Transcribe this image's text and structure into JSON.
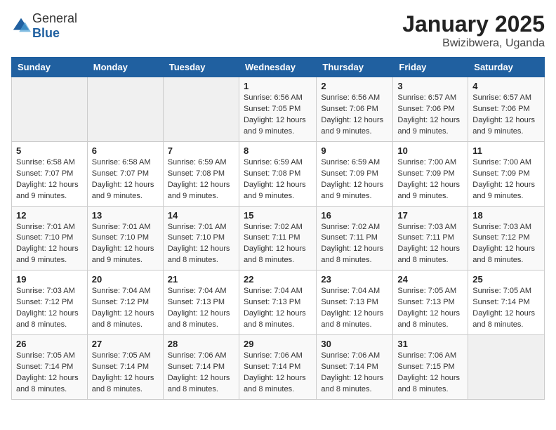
{
  "header": {
    "logo_general": "General",
    "logo_blue": "Blue",
    "title": "January 2025",
    "subtitle": "Bwizibwera, Uganda"
  },
  "weekdays": [
    "Sunday",
    "Monday",
    "Tuesday",
    "Wednesday",
    "Thursday",
    "Friday",
    "Saturday"
  ],
  "weeks": [
    [
      {
        "day": "",
        "sunrise": "",
        "sunset": "",
        "daylight": ""
      },
      {
        "day": "",
        "sunrise": "",
        "sunset": "",
        "daylight": ""
      },
      {
        "day": "",
        "sunrise": "",
        "sunset": "",
        "daylight": ""
      },
      {
        "day": "1",
        "sunrise": "Sunrise: 6:56 AM",
        "sunset": "Sunset: 7:05 PM",
        "daylight": "Daylight: 12 hours and 9 minutes."
      },
      {
        "day": "2",
        "sunrise": "Sunrise: 6:56 AM",
        "sunset": "Sunset: 7:06 PM",
        "daylight": "Daylight: 12 hours and 9 minutes."
      },
      {
        "day": "3",
        "sunrise": "Sunrise: 6:57 AM",
        "sunset": "Sunset: 7:06 PM",
        "daylight": "Daylight: 12 hours and 9 minutes."
      },
      {
        "day": "4",
        "sunrise": "Sunrise: 6:57 AM",
        "sunset": "Sunset: 7:06 PM",
        "daylight": "Daylight: 12 hours and 9 minutes."
      }
    ],
    [
      {
        "day": "5",
        "sunrise": "Sunrise: 6:58 AM",
        "sunset": "Sunset: 7:07 PM",
        "daylight": "Daylight: 12 hours and 9 minutes."
      },
      {
        "day": "6",
        "sunrise": "Sunrise: 6:58 AM",
        "sunset": "Sunset: 7:07 PM",
        "daylight": "Daylight: 12 hours and 9 minutes."
      },
      {
        "day": "7",
        "sunrise": "Sunrise: 6:59 AM",
        "sunset": "Sunset: 7:08 PM",
        "daylight": "Daylight: 12 hours and 9 minutes."
      },
      {
        "day": "8",
        "sunrise": "Sunrise: 6:59 AM",
        "sunset": "Sunset: 7:08 PM",
        "daylight": "Daylight: 12 hours and 9 minutes."
      },
      {
        "day": "9",
        "sunrise": "Sunrise: 6:59 AM",
        "sunset": "Sunset: 7:09 PM",
        "daylight": "Daylight: 12 hours and 9 minutes."
      },
      {
        "day": "10",
        "sunrise": "Sunrise: 7:00 AM",
        "sunset": "Sunset: 7:09 PM",
        "daylight": "Daylight: 12 hours and 9 minutes."
      },
      {
        "day": "11",
        "sunrise": "Sunrise: 7:00 AM",
        "sunset": "Sunset: 7:09 PM",
        "daylight": "Daylight: 12 hours and 9 minutes."
      }
    ],
    [
      {
        "day": "12",
        "sunrise": "Sunrise: 7:01 AM",
        "sunset": "Sunset: 7:10 PM",
        "daylight": "Daylight: 12 hours and 9 minutes."
      },
      {
        "day": "13",
        "sunrise": "Sunrise: 7:01 AM",
        "sunset": "Sunset: 7:10 PM",
        "daylight": "Daylight: 12 hours and 9 minutes."
      },
      {
        "day": "14",
        "sunrise": "Sunrise: 7:01 AM",
        "sunset": "Sunset: 7:10 PM",
        "daylight": "Daylight: 12 hours and 8 minutes."
      },
      {
        "day": "15",
        "sunrise": "Sunrise: 7:02 AM",
        "sunset": "Sunset: 7:11 PM",
        "daylight": "Daylight: 12 hours and 8 minutes."
      },
      {
        "day": "16",
        "sunrise": "Sunrise: 7:02 AM",
        "sunset": "Sunset: 7:11 PM",
        "daylight": "Daylight: 12 hours and 8 minutes."
      },
      {
        "day": "17",
        "sunrise": "Sunrise: 7:03 AM",
        "sunset": "Sunset: 7:11 PM",
        "daylight": "Daylight: 12 hours and 8 minutes."
      },
      {
        "day": "18",
        "sunrise": "Sunrise: 7:03 AM",
        "sunset": "Sunset: 7:12 PM",
        "daylight": "Daylight: 12 hours and 8 minutes."
      }
    ],
    [
      {
        "day": "19",
        "sunrise": "Sunrise: 7:03 AM",
        "sunset": "Sunset: 7:12 PM",
        "daylight": "Daylight: 12 hours and 8 minutes."
      },
      {
        "day": "20",
        "sunrise": "Sunrise: 7:04 AM",
        "sunset": "Sunset: 7:12 PM",
        "daylight": "Daylight: 12 hours and 8 minutes."
      },
      {
        "day": "21",
        "sunrise": "Sunrise: 7:04 AM",
        "sunset": "Sunset: 7:13 PM",
        "daylight": "Daylight: 12 hours and 8 minutes."
      },
      {
        "day": "22",
        "sunrise": "Sunrise: 7:04 AM",
        "sunset": "Sunset: 7:13 PM",
        "daylight": "Daylight: 12 hours and 8 minutes."
      },
      {
        "day": "23",
        "sunrise": "Sunrise: 7:04 AM",
        "sunset": "Sunset: 7:13 PM",
        "daylight": "Daylight: 12 hours and 8 minutes."
      },
      {
        "day": "24",
        "sunrise": "Sunrise: 7:05 AM",
        "sunset": "Sunset: 7:13 PM",
        "daylight": "Daylight: 12 hours and 8 minutes."
      },
      {
        "day": "25",
        "sunrise": "Sunrise: 7:05 AM",
        "sunset": "Sunset: 7:14 PM",
        "daylight": "Daylight: 12 hours and 8 minutes."
      }
    ],
    [
      {
        "day": "26",
        "sunrise": "Sunrise: 7:05 AM",
        "sunset": "Sunset: 7:14 PM",
        "daylight": "Daylight: 12 hours and 8 minutes."
      },
      {
        "day": "27",
        "sunrise": "Sunrise: 7:05 AM",
        "sunset": "Sunset: 7:14 PM",
        "daylight": "Daylight: 12 hours and 8 minutes."
      },
      {
        "day": "28",
        "sunrise": "Sunrise: 7:06 AM",
        "sunset": "Sunset: 7:14 PM",
        "daylight": "Daylight: 12 hours and 8 minutes."
      },
      {
        "day": "29",
        "sunrise": "Sunrise: 7:06 AM",
        "sunset": "Sunset: 7:14 PM",
        "daylight": "Daylight: 12 hours and 8 minutes."
      },
      {
        "day": "30",
        "sunrise": "Sunrise: 7:06 AM",
        "sunset": "Sunset: 7:14 PM",
        "daylight": "Daylight: 12 hours and 8 minutes."
      },
      {
        "day": "31",
        "sunrise": "Sunrise: 7:06 AM",
        "sunset": "Sunset: 7:15 PM",
        "daylight": "Daylight: 12 hours and 8 minutes."
      },
      {
        "day": "",
        "sunrise": "",
        "sunset": "",
        "daylight": ""
      }
    ]
  ]
}
